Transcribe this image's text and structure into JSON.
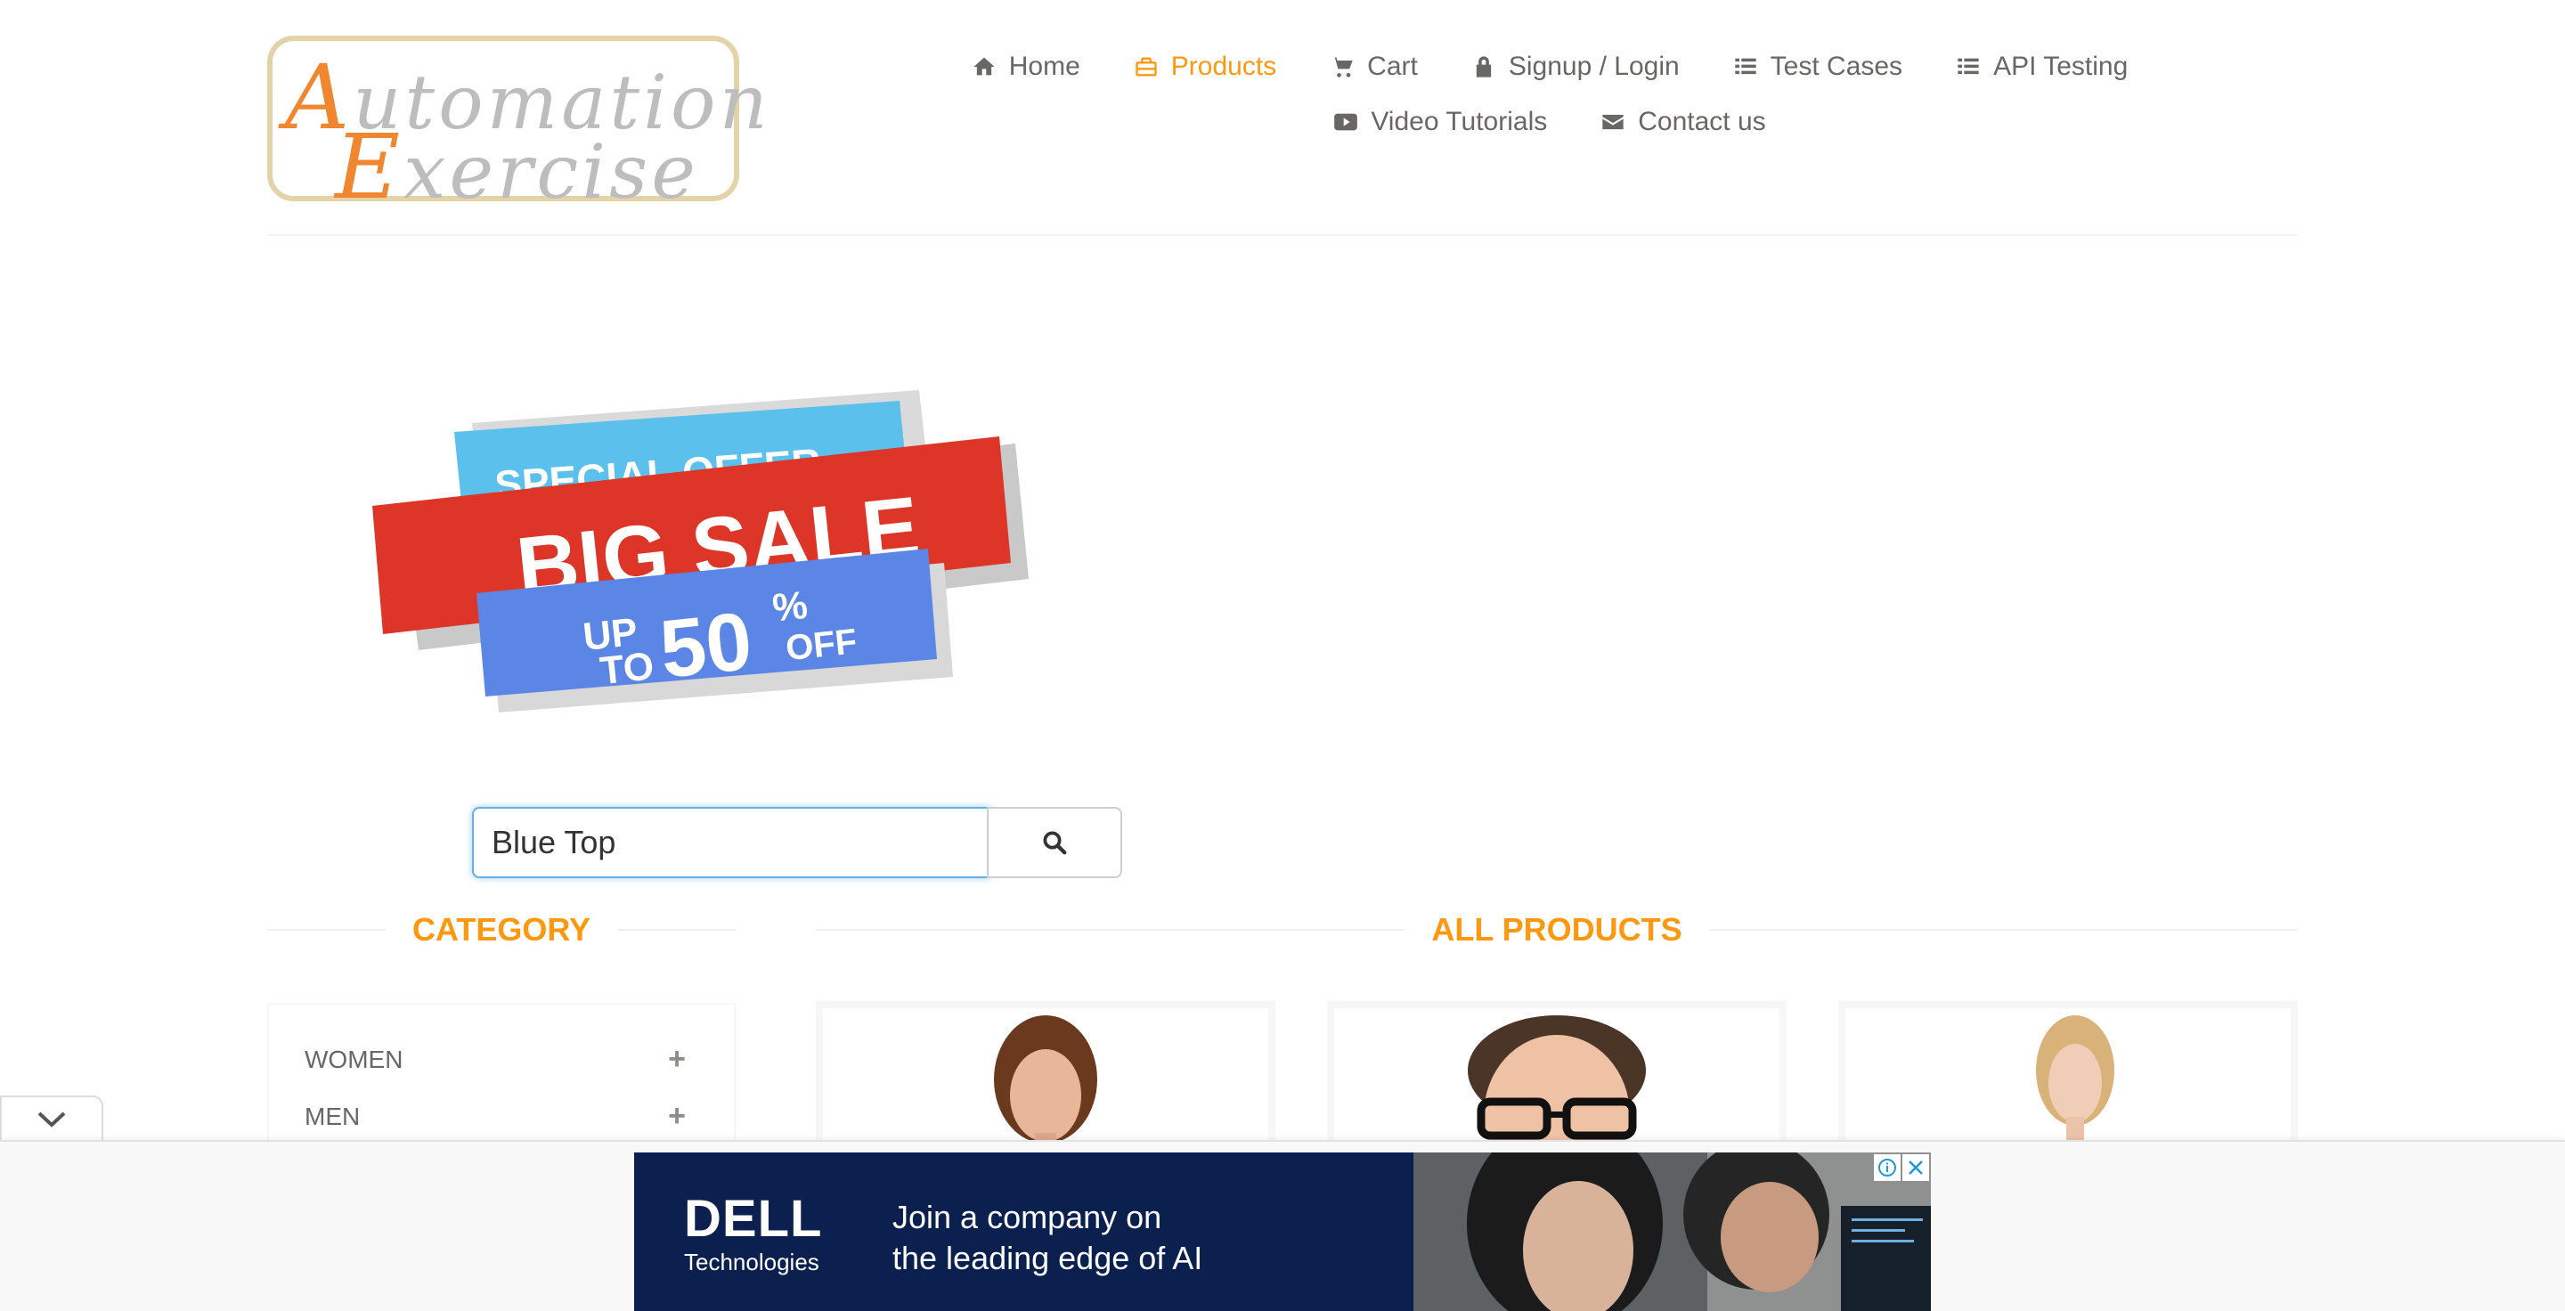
{
  "logo": {
    "line1_cap": "A",
    "line1_rest": "utomation",
    "line2_cap": "E",
    "line2_rest": "xercise"
  },
  "nav": {
    "items": [
      {
        "label": "Home",
        "icon": "home-icon"
      },
      {
        "label": "Products",
        "icon": "briefcase-icon",
        "active": true
      },
      {
        "label": "Cart",
        "icon": "cart-icon"
      },
      {
        "label": "Signup / Login",
        "icon": "lock-icon"
      },
      {
        "label": "Test Cases",
        "icon": "list-icon"
      },
      {
        "label": "API Testing",
        "icon": "list-icon"
      },
      {
        "label": "Video Tutorials",
        "icon": "youtube-play-icon"
      },
      {
        "label": "Contact us",
        "icon": "envelope-icon"
      }
    ]
  },
  "banner": {
    "line1": "SPECIAL OFFER",
    "line2": "BIG SALE",
    "up": "UP",
    "to": "TO",
    "value": "50",
    "percent": "%",
    "off": "OFF"
  },
  "search": {
    "value": "Blue Top",
    "button_icon": "search-icon"
  },
  "category": {
    "title": "CATEGORY",
    "items": [
      {
        "label": "WOMEN"
      },
      {
        "label": "MEN"
      }
    ],
    "expand_symbol": "+"
  },
  "products": {
    "title": "ALL PRODUCTS"
  },
  "ad": {
    "brand": "DELL",
    "brand_sub": "Technologies",
    "line1": "Join a company on",
    "line2": "the leading edge of AI"
  },
  "colors": {
    "accent": "#FE980F",
    "text": "#696763",
    "ad_bg": "#0C2050",
    "focus": "#66AFE9"
  }
}
